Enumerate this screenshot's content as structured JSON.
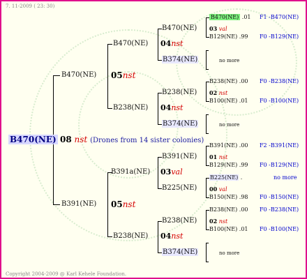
{
  "header": {
    "date": "7. 11-2009 ( 23: 30)"
  },
  "footer": {
    "copyright": "Copyright 2004-2009 @ Karl Kehele Foundation."
  },
  "root": {
    "name": "B470(NE)",
    "year": "08",
    "mate": "nst",
    "note": "(Drones from 14 sister colonies)"
  },
  "gen1": [
    {
      "name": "B470(NE)",
      "year": "05",
      "mate": "nst"
    },
    {
      "name": "B391(NE)",
      "year": "05",
      "mate": "nst"
    }
  ],
  "gen2": [
    {
      "name": "B470(NE)",
      "year": "04",
      "mate": "nst"
    },
    {
      "name": "B238(NE)",
      "year": "04",
      "mate": "nst"
    },
    {
      "name": "B391a(NE)",
      "year": "03",
      "mate": "val"
    },
    {
      "name": "B238(NE)",
      "year": "04",
      "mate": "nst"
    }
  ],
  "gen3": [
    {
      "name": "B470(NE)",
      "year": "03",
      "mate": "val"
    },
    {
      "name": "B374(NE)",
      "nomore": "no more"
    },
    {
      "name": "B238(NE)",
      "year": "02",
      "mate": "nst"
    },
    {
      "name": "B374(NE)",
      "nomore": "no more"
    },
    {
      "name": "B391(NE)",
      "year": "01",
      "mate": "nst"
    },
    {
      "name": "B225(NE)",
      "year": "00",
      "mate": "val"
    },
    {
      "name": "B238(NE)",
      "year": "02",
      "mate": "nst"
    },
    {
      "name": "B374(NE)",
      "nomore": "no more"
    }
  ],
  "gen4": [
    {
      "name": "B470(NE)",
      "value": ".01",
      "ref": "F1 -B470(NE)"
    },
    {
      "name": "B129(NE)",
      "value": ".99",
      "ref": "F0 -B129(NE)"
    },
    {
      "name": "B238(NE)",
      "value": ".00",
      "ref": "F0 -B238(NE)"
    },
    {
      "name": "B100(NE)",
      "value": ".01",
      "ref": "F0 -B100(NE)"
    },
    {
      "name": "B391(NE)",
      "value": ".00",
      "ref": "F2 -B391(NE)"
    },
    {
      "name": "B129(NE)",
      "value": ".99",
      "ref": "F0 -B129(NE)"
    },
    {
      "name": "B225(NE)",
      "value": ".",
      "ref": "no more"
    },
    {
      "name": "B150(NE)",
      "value": ".98",
      "ref": "F0 -B150(NE)"
    },
    {
      "name": "B238(NE)",
      "value": ".00",
      "ref": "F0 -B238(NE)"
    },
    {
      "name": "B100(NE)",
      "value": ".01",
      "ref": "F0 -B100(NE)"
    }
  ],
  "colors": {
    "frame": "#e0108c",
    "highlight": "#7ef07e",
    "reference": "#0000cc",
    "mate": "#d40000"
  }
}
